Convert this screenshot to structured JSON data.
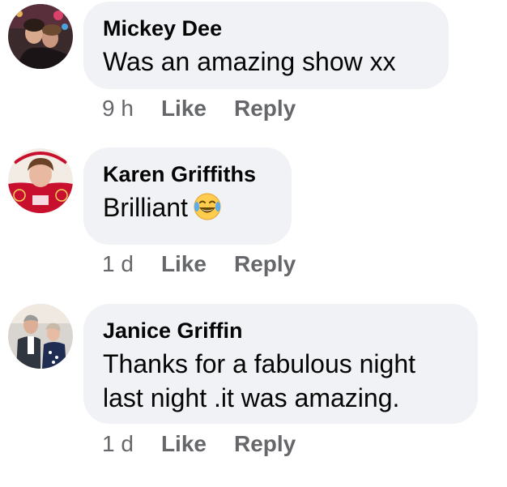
{
  "comments": [
    {
      "author": "Mickey Dee",
      "text": "Was an amazing show xx",
      "time": "9 h",
      "like_label": "Like",
      "reply_label": "Reply",
      "avatar_icon": "profile-photo-icon"
    },
    {
      "author": "Karen Griffiths",
      "text": "Brilliant",
      "emoji": "face-with-tears-of-joy-icon",
      "time": "1 d",
      "like_label": "Like",
      "reply_label": "Reply",
      "avatar_icon": "profile-photo-icon"
    },
    {
      "author": "Janice Griffin",
      "text_line1": "Thanks for a fabulous night",
      "text_line2": "last night .it was amazing.",
      "time": "1 d",
      "like_label": "Like",
      "reply_label": "Reply",
      "avatar_icon": "profile-photo-icon"
    }
  ],
  "colors": {
    "bubble": "#f0f2f5",
    "meta_text": "#65676b",
    "body_text": "#050505"
  }
}
